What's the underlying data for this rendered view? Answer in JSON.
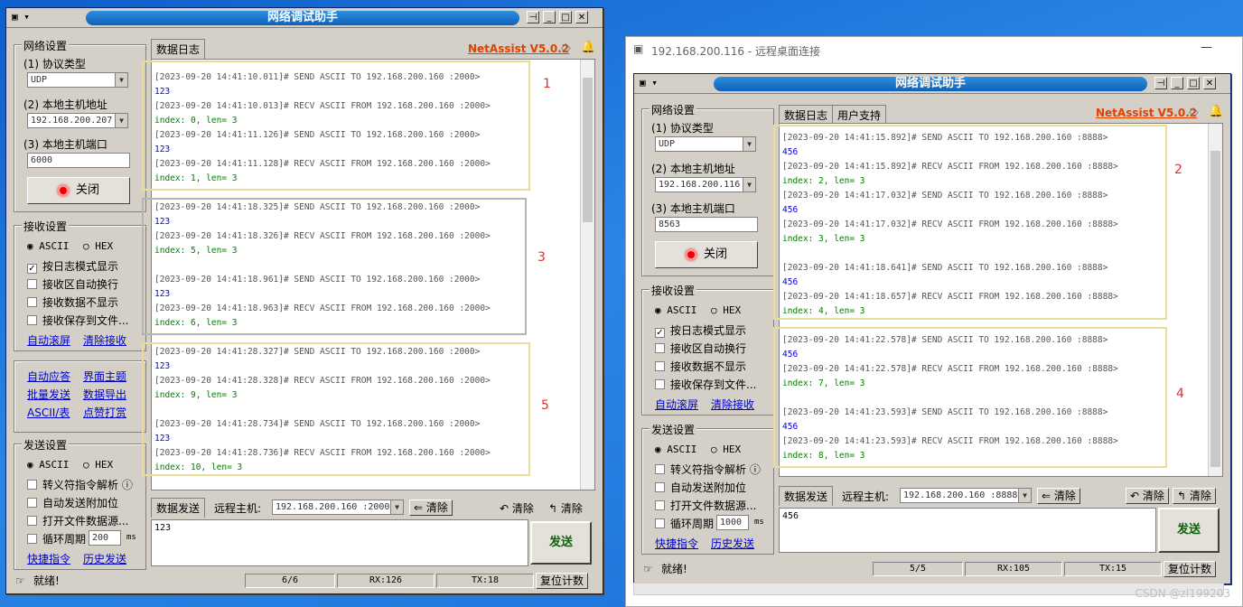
{
  "left": {
    "title": "网络调试助手",
    "net_settings": "网络设置",
    "protocol_label": "(1) 协议类型",
    "protocol_value": "UDP",
    "local_ip_label": "(2) 本地主机地址",
    "local_ip_value": "192.168.200.207",
    "local_port_label": "(3) 本地主机端口",
    "local_port_value": "6000",
    "close_button": "关闭",
    "recv_settings": "接收设置",
    "ascii": "ASCII",
    "hex": "HEX",
    "recv_opts": [
      "按日志模式显示",
      "接收区自动换行",
      "接收数据不显示",
      "接收保存到文件..."
    ],
    "auto_scroll": "自动滚屏",
    "clear_recv": "清除接收",
    "tools": [
      "自动应答",
      "界面主题",
      "批量发送",
      "数据导出",
      "ASCII/表",
      "点赞打赏"
    ],
    "send_settings": "发送设置",
    "send_opts": [
      "转义符指令解析",
      "自动发送附加位",
      "打开文件数据源...",
      "循环周期"
    ],
    "cycle_value": "200",
    "cycle_unit": "ms",
    "quick_cmd": "快捷指令",
    "history_send": "历史发送",
    "tab_log": "数据日志",
    "brand": "NetAssist V5.0.2",
    "log": [
      {
        "c": "send",
        "t": "[2023-09-20 14:41:10.011]# SEND ASCII TO 192.168.200.160 :2000>"
      },
      {
        "c": "data",
        "t": "123"
      },
      {
        "c": "recv",
        "t": "[2023-09-20 14:41:10.013]# RECV ASCII FROM 192.168.200.160 :2000>"
      },
      {
        "c": "idx",
        "t": "index:   0, len=   3"
      },
      {
        "c": "send",
        "t": "[2023-09-20 14:41:11.126]# SEND ASCII TO 192.168.200.160 :2000>"
      },
      {
        "c": "data",
        "t": "123"
      },
      {
        "c": "recv",
        "t": "[2023-09-20 14:41:11.128]# RECV ASCII FROM 192.168.200.160 :2000>"
      },
      {
        "c": "idx",
        "t": "index:   1, len=   3"
      },
      {
        "c": "blank",
        "t": ""
      },
      {
        "c": "send",
        "t": "[2023-09-20 14:41:18.325]# SEND ASCII TO 192.168.200.160 :2000>"
      },
      {
        "c": "data",
        "t": "123"
      },
      {
        "c": "recv",
        "t": "[2023-09-20 14:41:18.326]# RECV ASCII FROM 192.168.200.160 :2000>"
      },
      {
        "c": "idx",
        "t": "index:   5, len=   3"
      },
      {
        "c": "blank",
        "t": ""
      },
      {
        "c": "send",
        "t": "[2023-09-20 14:41:18.961]# SEND ASCII TO 192.168.200.160 :2000>"
      },
      {
        "c": "data",
        "t": "123"
      },
      {
        "c": "recv",
        "t": "[2023-09-20 14:41:18.963]# RECV ASCII FROM 192.168.200.160 :2000>"
      },
      {
        "c": "idx",
        "t": "index:   6, len=   3"
      },
      {
        "c": "blank",
        "t": ""
      },
      {
        "c": "send",
        "t": "[2023-09-20 14:41:28.327]# SEND ASCII TO 192.168.200.160 :2000>"
      },
      {
        "c": "data",
        "t": "123"
      },
      {
        "c": "recv",
        "t": "[2023-09-20 14:41:28.328]# RECV ASCII FROM 192.168.200.160 :2000>"
      },
      {
        "c": "idx",
        "t": "index:   9, len=   3"
      },
      {
        "c": "blank",
        "t": ""
      },
      {
        "c": "send",
        "t": "[2023-09-20 14:41:28.734]# SEND ASCII TO 192.168.200.160 :2000>"
      },
      {
        "c": "data",
        "t": "123"
      },
      {
        "c": "recv",
        "t": "[2023-09-20 14:41:28.736]# RECV ASCII FROM 192.168.200.160 :2000>"
      },
      {
        "c": "idx",
        "t": "index:  10, len=   3"
      }
    ],
    "annotations": [
      "1",
      "3",
      "5"
    ],
    "send_tab": "数据发送",
    "remote_label": "远程主机:",
    "remote_value": "192.168.200.160 :2000",
    "clear": "清除",
    "clear2": "清除",
    "clear3": "清除",
    "send_text": "123",
    "send_button": "发送",
    "status_ready": "就绪!",
    "count": "6/6",
    "rx": "RX:126",
    "tx": "TX:18",
    "reset": "复位计数"
  },
  "right": {
    "rdp_title": "192.168.200.116 - 远程桌面连接",
    "title": "网络调试助手",
    "net_settings": "网络设置",
    "protocol_label": "(1) 协议类型",
    "protocol_value": "UDP",
    "local_ip_label": "(2) 本地主机地址",
    "local_ip_value": "192.168.200.116",
    "local_port_label": "(3) 本地主机端口",
    "local_port_value": "8563",
    "close_button": "关闭",
    "recv_settings": "接收设置",
    "ascii": "ASCII",
    "hex": "HEX",
    "recv_opts": [
      "按日志模式显示",
      "接收区自动换行",
      "接收数据不显示",
      "接收保存到文件..."
    ],
    "auto_scroll": "自动滚屏",
    "clear_recv": "清除接收",
    "send_settings": "发送设置",
    "send_opts": [
      "转义符指令解析",
      "自动发送附加位",
      "打开文件数据源...",
      "循环周期"
    ],
    "cycle_value": "1000",
    "cycle_unit": "ms",
    "quick_cmd": "快捷指令",
    "history_send": "历史发送",
    "tab_log": "数据日志",
    "tab_user": "用户支持",
    "brand": "NetAssist V5.0.2",
    "log": [
      {
        "c": "send",
        "t": "[2023-09-20 14:41:15.892]# SEND ASCII TO 192.168.200.160 :8888>"
      },
      {
        "c": "data",
        "t": "456"
      },
      {
        "c": "recv",
        "t": "[2023-09-20 14:41:15.892]# RECV ASCII FROM 192.168.200.160 :8888>"
      },
      {
        "c": "idx",
        "t": "index:   2, len=   3"
      },
      {
        "c": "send",
        "t": "[2023-09-20 14:41:17.032]# SEND ASCII TO 192.168.200.160 :8888>"
      },
      {
        "c": "data",
        "t": "456"
      },
      {
        "c": "recv",
        "t": "[2023-09-20 14:41:17.032]# RECV ASCII FROM 192.168.200.160 :8888>"
      },
      {
        "c": "idx",
        "t": "index:   3, len=   3"
      },
      {
        "c": "blank",
        "t": ""
      },
      {
        "c": "send",
        "t": "[2023-09-20 14:41:18.641]# SEND ASCII TO 192.168.200.160 :8888>"
      },
      {
        "c": "data",
        "t": "456"
      },
      {
        "c": "recv",
        "t": "[2023-09-20 14:41:18.657]# RECV ASCII FROM 192.168.200.160 :8888>"
      },
      {
        "c": "idx",
        "t": "index:   4, len=   3"
      },
      {
        "c": "blank",
        "t": ""
      },
      {
        "c": "send",
        "t": "[2023-09-20 14:41:22.578]# SEND ASCII TO 192.168.200.160 :8888>"
      },
      {
        "c": "data",
        "t": "456"
      },
      {
        "c": "recv",
        "t": "[2023-09-20 14:41:22.578]# RECV ASCII FROM 192.168.200.160 :8888>"
      },
      {
        "c": "idx",
        "t": "index:   7, len=   3"
      },
      {
        "c": "blank",
        "t": ""
      },
      {
        "c": "send",
        "t": "[2023-09-20 14:41:23.593]# SEND ASCII TO 192.168.200.160 :8888>"
      },
      {
        "c": "data",
        "t": "456"
      },
      {
        "c": "recv",
        "t": "[2023-09-20 14:41:23.593]# RECV ASCII FROM 192.168.200.160 :8888>"
      },
      {
        "c": "idx",
        "t": "index:   8, len=   3"
      }
    ],
    "annotations": [
      "2",
      "4"
    ],
    "send_tab": "数据发送",
    "remote_label": "远程主机:",
    "remote_value": "192.168.200.160 :8888",
    "clear": "清除",
    "clear2": "清除",
    "clear3": "清除",
    "send_text": "456",
    "send_button": "发送",
    "status_ready": "就绪!",
    "count": "5/5",
    "rx": "RX:105",
    "tx": "TX:15",
    "reset": "复位计数"
  },
  "watermark": "CSDN @zl199203"
}
